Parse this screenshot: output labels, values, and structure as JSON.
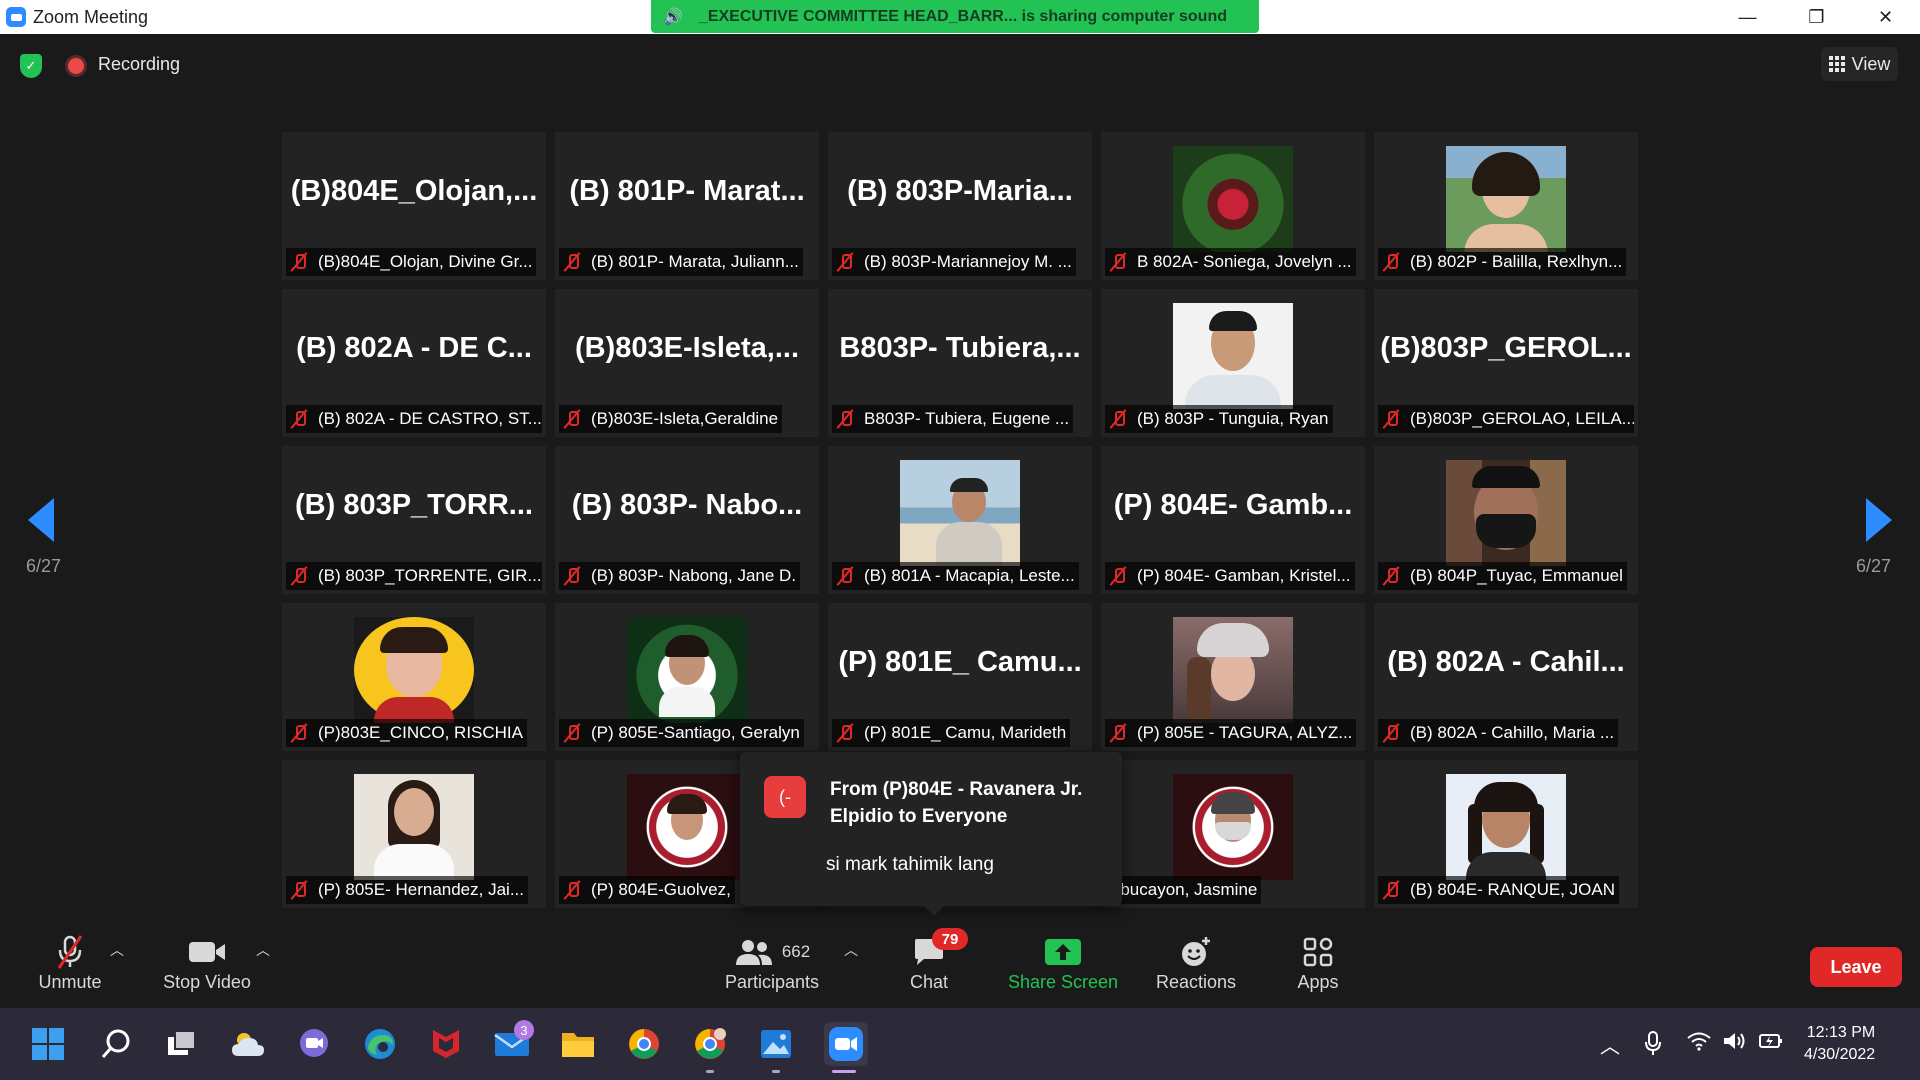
{
  "window": {
    "title": "Zoom Meeting",
    "minimize": "—",
    "restore": "❐",
    "close": "✕"
  },
  "share_banner": {
    "text": "_EXECUTIVE COMMITTEE HEAD_BARR... is sharing computer sound",
    "color": "#23c254"
  },
  "top": {
    "recording": "Recording",
    "view": "View"
  },
  "pagination": {
    "left": "6/27",
    "right": "6/27"
  },
  "tiles": [
    {
      "big": "(B)804E_Olojan,...",
      "label": "(B)804E_Olojan, Divine Gr..."
    },
    {
      "big": "(B) 801P- Marat...",
      "label": "(B) 801P- Marata, Juliann..."
    },
    {
      "big": "(B) 803P-Maria...",
      "label": "(B) 803P-Mariannejoy M. ..."
    },
    {
      "big": "",
      "label": "B 802A- Soniega, Jovelyn ..."
    },
    {
      "big": "",
      "label": "(B) 802P - Balilla, Rexlhyn..."
    },
    {
      "big": "(B) 802A - DE C...",
      "label": "(B) 802A - DE CASTRO, ST..."
    },
    {
      "big": "(B)803E-Isleta,...",
      "label": "(B)803E-Isleta,Geraldine"
    },
    {
      "big": "B803P- Tubiera,...",
      "label": "B803P- Tubiera, Eugene ..."
    },
    {
      "big": "",
      "label": "(B) 803P - Tunguia, Ryan"
    },
    {
      "big": "(B)803P_GEROL...",
      "label": "(B)803P_GEROLAO, LEILA..."
    },
    {
      "big": "(B) 803P_TORR...",
      "label": "(B) 803P_TORRENTE, GIR..."
    },
    {
      "big": "(B) 803P- Nabo...",
      "label": "(B) 803P- Nabong, Jane D."
    },
    {
      "big": "",
      "label": "(B) 801A - Macapia, Leste..."
    },
    {
      "big": "(P) 804E- Gamb...",
      "label": "(P) 804E- Gamban, Kristel..."
    },
    {
      "big": "",
      "label": "(B) 804P_Tuyac, Emmanuel"
    },
    {
      "big": "",
      "label": "(P)803E_CINCO, RISCHIA"
    },
    {
      "big": "",
      "label": "(P) 805E-Santiago, Geralyn"
    },
    {
      "big": "(P) 801E_ Camu...",
      "label": "(P) 801E_ Camu, Marideth"
    },
    {
      "big": "",
      "label": "(P) 805E - TAGURA, ALYZ..."
    },
    {
      "big": "(B) 802A - Cahil...",
      "label": "(B) 802A - Cahillo, Maria ..."
    },
    {
      "big": "",
      "label": "(P) 805E- Hernandez, Jai..."
    },
    {
      "big": "",
      "label": "(P) 804E-Guolvez,"
    },
    {
      "big": "",
      "label": ""
    },
    {
      "big": "",
      "label": "Abucayon, Jasmine"
    },
    {
      "big": "",
      "label": "(B) 804E- RANQUE, JOAN"
    }
  ],
  "chat_popup": {
    "avatar": "(-",
    "from": "From (P)804E - Ravanera Jr. Elpidio to Everyone",
    "message": "si mark tahimik lang"
  },
  "toolbar": {
    "unmute": "Unmute",
    "stop_video": "Stop Video",
    "participants": "Participants",
    "participants_count": "662",
    "chat": "Chat",
    "chat_badge": "79",
    "share_screen": "Share Screen",
    "reactions": "Reactions",
    "apps": "Apps",
    "leave": "Leave",
    "share_color": "#23c254"
  },
  "taskbar": {
    "mail_badge": "3",
    "time": "12:13 PM",
    "date": "4/30/2022",
    "icons": [
      "windows-icon",
      "search-icon",
      "task-view-icon",
      "weather-icon",
      "teams-icon",
      "edge-icon",
      "mcafee-icon",
      "mail-icon",
      "file-explorer-icon",
      "chrome-icon",
      "chrome-profile-icon",
      "photos-icon",
      "zoom-icon"
    ]
  }
}
